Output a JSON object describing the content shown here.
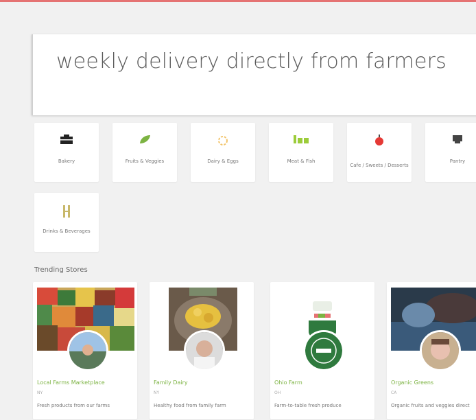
{
  "hero": {
    "text": "weekly delivery directly from farmers"
  },
  "categories": [
    {
      "label": "Bakery",
      "icon": "bread-box-icon"
    },
    {
      "label": "Fruits & Veggies",
      "icon": "leaf-icon"
    },
    {
      "label": "Dairy & Eggs",
      "icon": "egg-icon"
    },
    {
      "label": "Meat & Fish",
      "icon": "meat-icon"
    },
    {
      "label": "Cafe / Sweets / Desserts",
      "icon": "apple-icon"
    },
    {
      "label": "Pantry",
      "icon": "pantry-icon"
    },
    {
      "label": "Drinks & Beverages",
      "icon": "bottle-icon"
    }
  ],
  "section": {
    "title": "Trending Stores"
  },
  "stores": [
    {
      "name": "Local Farms Marketplace",
      "sub": "NY",
      "desc": "Fresh products from our farms"
    },
    {
      "name": "Family Dairy",
      "sub": "NY",
      "desc": "Healthy food from family farm"
    },
    {
      "name": "Ohio Farm",
      "sub": "OH",
      "desc": "Farm-to-table fresh produce"
    },
    {
      "name": "Organic Greens",
      "sub": "CA",
      "desc": "Organic fruits and veggies direct"
    }
  ],
  "colors": {
    "accent": "#7cb342",
    "topline": "#e57373"
  }
}
